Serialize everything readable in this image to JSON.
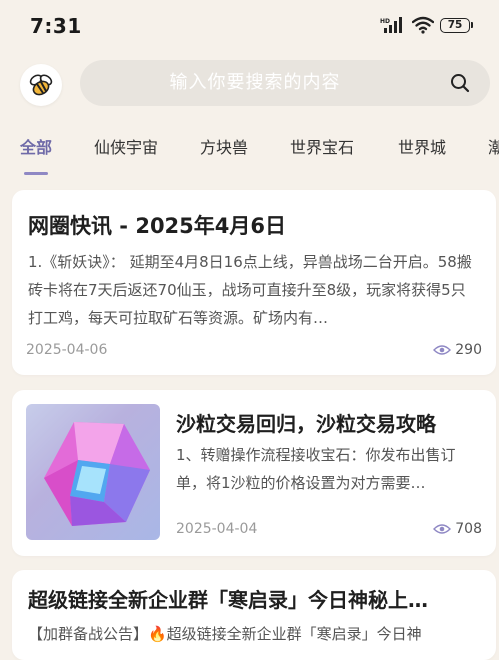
{
  "status_bar": {
    "time": "7:31",
    "battery": "75"
  },
  "search": {
    "placeholder": "输入你要搜索的内容"
  },
  "tabs": [
    {
      "label": "全部",
      "active": true
    },
    {
      "label": "仙侠宇宙"
    },
    {
      "label": "方块兽"
    },
    {
      "label": "世界宝石"
    },
    {
      "label": "世界城"
    },
    {
      "label": "潮"
    }
  ],
  "articles": [
    {
      "title": "网圈快讯 - 2025年4月6日",
      "summary": "1.《斩妖诀》： 延期至4月8日16点上线，异兽战场二台开启。58搬砖卡将在7天后返还70仙玉，战场可直接升至8级，玩家将获得5只打工鸡，每天可拉取矿石等资源。矿场内有…",
      "date": "2025-04-06",
      "views": "290"
    },
    {
      "title": "沙粒交易回归，沙粒交易攻略",
      "summary": "1、转赠操作流程接收宝石：你发布出售订单，将1沙粒的价格设置为对方需要…",
      "date": "2025-04-04",
      "views": "708"
    },
    {
      "title": "超级链接全新企业群「寒启录」今日神秘上…",
      "summary": "【加群备战公告】🔥超级链接全新企业群「寒启录」今日神"
    }
  ],
  "colors": {
    "accent": "#6f6aa8",
    "background": "#f6f1ea",
    "card": "#ffffff",
    "search_bg": "#e8e4de"
  }
}
